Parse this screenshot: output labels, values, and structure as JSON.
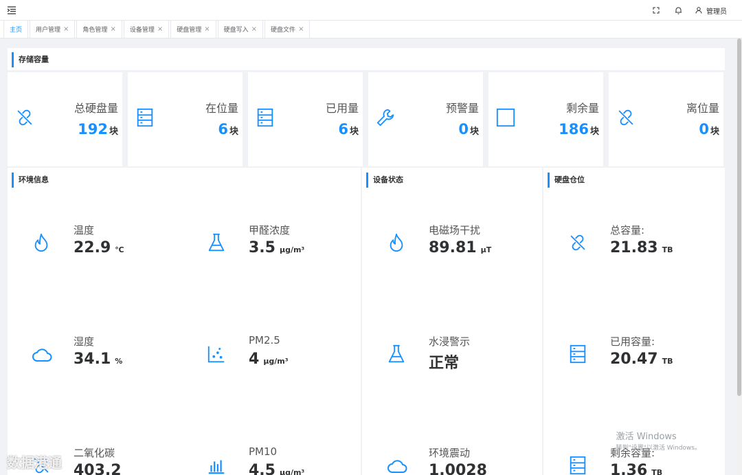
{
  "header": {
    "user_label": "管理员"
  },
  "tabs": [
    {
      "label": "主页"
    },
    {
      "label": "用户管理"
    },
    {
      "label": "角色管理"
    },
    {
      "label": "设备管理"
    },
    {
      "label": "硬盘管理"
    },
    {
      "label": "硬盘写入"
    },
    {
      "label": "硬盘文件"
    }
  ],
  "storage": {
    "title": "存储容量",
    "cards": [
      {
        "label": "总硬盘量",
        "value": "192",
        "unit": "块",
        "icon": "link-off-icon"
      },
      {
        "label": "在位量",
        "value": "6",
        "unit": "块",
        "icon": "server-icon"
      },
      {
        "label": "已用量",
        "value": "6",
        "unit": "块",
        "icon": "server-icon"
      },
      {
        "label": "预警量",
        "value": "0",
        "unit": "块",
        "icon": "wrench-icon"
      },
      {
        "label": "剩余量",
        "value": "186",
        "unit": "块",
        "icon": "square-icon"
      },
      {
        "label": "离位量",
        "value": "0",
        "unit": "块",
        "icon": "link-off-icon"
      }
    ]
  },
  "environment": {
    "title": "环境信息",
    "items": [
      {
        "label": "温度",
        "value": "22.9",
        "unit": "℃",
        "icon": "fire-icon"
      },
      {
        "label": "甲醛浓度",
        "value": "3.5",
        "unit": "μg/m³",
        "icon": "flask-icon"
      },
      {
        "label": "湿度",
        "value": "34.1",
        "unit": "%",
        "icon": "cloud-icon"
      },
      {
        "label": "PM2.5",
        "value": "4",
        "unit": "μg/m³",
        "icon": "scatter-icon"
      },
      {
        "label": "二氧化碳",
        "value": "403.2",
        "unit": "",
        "icon": "link-off-icon"
      },
      {
        "label": "PM10",
        "value": "4.5",
        "unit": "μg/m³",
        "icon": "bar-chart-icon"
      }
    ]
  },
  "device": {
    "title": "设备状态",
    "items": [
      {
        "label": "电磁场干扰",
        "value": "89.81",
        "unit": "μT",
        "icon": "fire-icon"
      },
      {
        "label": "水浸警示",
        "value": "正常",
        "unit": "",
        "icon": "flask-icon"
      },
      {
        "label": "环境震动",
        "value": "1.0028",
        "unit": "",
        "icon": "cloud-icon"
      }
    ]
  },
  "warehouse": {
    "title": "硬盘仓位",
    "items": [
      {
        "label": "总容量:",
        "value": "21.83",
        "unit": "TB",
        "icon": "link-off-icon"
      },
      {
        "label": "已用容量:",
        "value": "20.47",
        "unit": "TB",
        "icon": "server-icon"
      },
      {
        "label": "剩余容量:",
        "value": "1.36",
        "unit": "TB",
        "icon": "server-icon"
      }
    ]
  },
  "watermark": {
    "line1": "激活 Windows",
    "line2": "转到\"设置\"以激活 Windows。"
  },
  "brand": "数据港通",
  "colors": {
    "accent": "#1890ff"
  }
}
